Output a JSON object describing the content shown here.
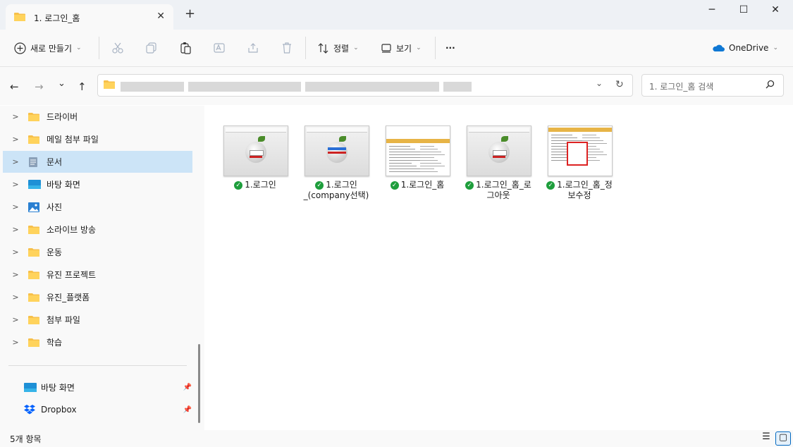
{
  "window": {
    "tab_title": "1. 로그인_홈",
    "tab_close": "✕",
    "new_tab": "+",
    "min": "─",
    "max": "☐",
    "close": "✕"
  },
  "toolbar": {
    "new_label": "새로 만들기",
    "sort_label": "정렬",
    "view_label": "보기",
    "more_label": "···",
    "onedrive_label": "OneDrive"
  },
  "address": {
    "back": "←",
    "forward": "→",
    "recent": "⌄",
    "up": "↑",
    "dropdown": "⌄",
    "refresh": "↻",
    "search_placeholder": "1. 로그인_홈 검색"
  },
  "sidebar": {
    "items": [
      {
        "label": "드라이버",
        "icon": "folder-icon"
      },
      {
        "label": "메일 첨부 파일",
        "icon": "folder-icon"
      },
      {
        "label": "문서",
        "icon": "documents-icon"
      },
      {
        "label": "바탕 화면",
        "icon": "desktop-icon"
      },
      {
        "label": "사진",
        "icon": "pictures-icon"
      },
      {
        "label": "소라이브 방송",
        "icon": "folder-icon"
      },
      {
        "label": "운동",
        "icon": "folder-icon"
      },
      {
        "label": "유진 프로젝트",
        "icon": "folder-icon"
      },
      {
        "label": "유진_플랫폼",
        "icon": "folder-icon"
      },
      {
        "label": "첨부 파일",
        "icon": "folder-icon"
      },
      {
        "label": "학습",
        "icon": "folder-icon"
      }
    ],
    "quick_access": [
      {
        "label": "바탕 화면",
        "icon": "desktop-icon"
      },
      {
        "label": "Dropbox",
        "icon": "dropbox-icon"
      }
    ]
  },
  "files": [
    {
      "name": "1.로그인",
      "thumb": "login"
    },
    {
      "name": "1.로그인_(company선택)",
      "thumb": "login-company"
    },
    {
      "name": "1.로그인_홈",
      "thumb": "home"
    },
    {
      "name": "1.로그인_홈_로그아웃",
      "thumb": "login"
    },
    {
      "name": "1.로그인_홈_정보수정",
      "thumb": "home-edit"
    }
  ],
  "status": {
    "count": "5개 항목"
  },
  "colors": {
    "accent": "#0067c0",
    "selection": "#cce4f7",
    "folder": "#f7c04a",
    "sync_check": "#1e9e3c"
  }
}
